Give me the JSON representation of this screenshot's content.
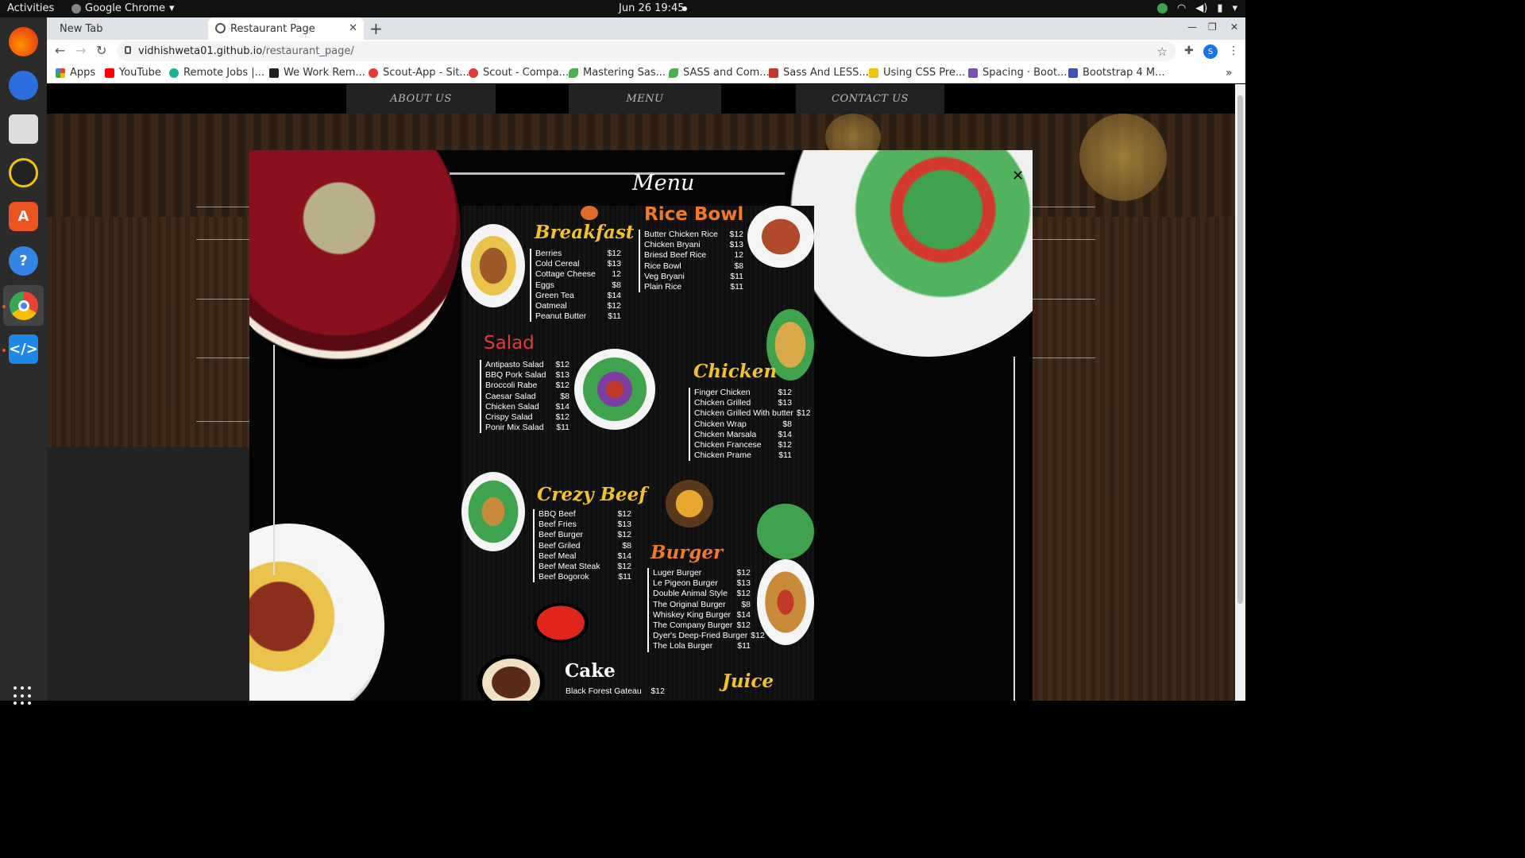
{
  "system": {
    "activities": "Activities",
    "app_name": "Google Chrome",
    "clock": "Jun 26  19:45"
  },
  "browser": {
    "tabs": [
      {
        "title": "New Tab"
      },
      {
        "title": "Restaurant Page"
      }
    ],
    "url_host": "vidhishweta01.github.io",
    "url_path": "/restaurant_page/",
    "profile_initial": "S",
    "bookmarks": [
      {
        "label": "Apps",
        "color": "#4285f4"
      },
      {
        "label": "YouTube",
        "color": "#ff0000"
      },
      {
        "label": "Remote Jobs |...",
        "color": "#1ab394"
      },
      {
        "label": "We Work Rem...",
        "color": "#222222"
      },
      {
        "label": "Scout-App - Sit...",
        "color": "#e53935"
      },
      {
        "label": "Scout - Compa...",
        "color": "#e53935"
      },
      {
        "label": "Mastering Sas...",
        "color": "#4caf50"
      },
      {
        "label": "SASS and Com...",
        "color": "#4caf50"
      },
      {
        "label": "Sass And LESS...",
        "color": "#c0392b"
      },
      {
        "label": "Using CSS Pre...",
        "color": "#f1c40f"
      },
      {
        "label": "Spacing · Boot...",
        "color": "#7952b3"
      },
      {
        "label": "Bootstrap 4 M...",
        "color": "#3f51b5"
      }
    ]
  },
  "site": {
    "nav": [
      "ABOUT US",
      "MENU",
      "CONTACT US"
    ]
  },
  "menu": {
    "title": "Menu",
    "sections": [
      {
        "title": "Breakfast",
        "color": "#f2c12e",
        "items": [
          {
            "name": "Berries",
            "price": "$12"
          },
          {
            "name": "Cold Cereal",
            "price": "$13"
          },
          {
            "name": "Cottage Cheese",
            "price": "12"
          },
          {
            "name": "Eggs",
            "price": "$8"
          },
          {
            "name": "Green Tea",
            "price": "$14"
          },
          {
            "name": "Oatmeal",
            "price": "$12"
          },
          {
            "name": "Peanut Butter",
            "price": "$11"
          }
        ]
      },
      {
        "title": "Rice Bowl",
        "color": "#f07a2a",
        "items": [
          {
            "name": "Butter Chicken Rice",
            "price": "$12"
          },
          {
            "name": "Chicken Bryani",
            "price": "$13"
          },
          {
            "name": "Briesd Beef Rice",
            "price": "12"
          },
          {
            "name": "Rice Bowl",
            "price": "$8"
          },
          {
            "name": "Veg Bryani",
            "price": "$11"
          },
          {
            "name": "Plain Rice",
            "price": "$11"
          }
        ]
      },
      {
        "title": "Salad",
        "color": "#e8363a",
        "items": [
          {
            "name": "Antipasto Salad",
            "price": "$12"
          },
          {
            "name": "BBQ Pork Salad",
            "price": "$13"
          },
          {
            "name": "Broccoli Rabe",
            "price": "$12"
          },
          {
            "name": "Caesar Salad",
            "price": "$8"
          },
          {
            "name": "Chicken Salad",
            "price": "$14"
          },
          {
            "name": "Crispy Salad",
            "price": "$12"
          },
          {
            "name": "Ponir Mix Salad",
            "price": "$11"
          }
        ]
      },
      {
        "title": "Chicken",
        "color": "#f2c12e",
        "items": [
          {
            "name": "Finger Chicken",
            "price": "$12"
          },
          {
            "name": "Chicken Grilled",
            "price": "$13"
          },
          {
            "name": "Chicken Grilled With butter",
            "price": "$12"
          },
          {
            "name": "Chicken Wrap",
            "price": "$8"
          },
          {
            "name": "Chicken Marsala",
            "price": "$14"
          },
          {
            "name": "Chicken Francese",
            "price": "$12"
          },
          {
            "name": "Chicken Prame",
            "price": "$11"
          }
        ]
      },
      {
        "title": "Crezy Beef",
        "color": "#f2c12e",
        "items": [
          {
            "name": "BBQ Beef",
            "price": "$12"
          },
          {
            "name": "Beef Fries",
            "price": "$13"
          },
          {
            "name": "Beef Burger",
            "price": "$12"
          },
          {
            "name": "Beef Griled",
            "price": "$8"
          },
          {
            "name": "Beef Meal",
            "price": "$14"
          },
          {
            "name": "Beef Meat Steak",
            "price": "$12"
          },
          {
            "name": "Beef Bogorok",
            "price": "$11"
          }
        ]
      },
      {
        "title": "Burger",
        "color": "#f07a2a",
        "items": [
          {
            "name": "Luger Burger",
            "price": "$12"
          },
          {
            "name": "Le Pigeon Burger",
            "price": "$13"
          },
          {
            "name": "Double Animal Style",
            "price": "$12"
          },
          {
            "name": "The Original Burger",
            "price": "$8"
          },
          {
            "name": "Whiskey King Burger",
            "price": "$14"
          },
          {
            "name": "The Company Burger",
            "price": "$12"
          },
          {
            "name": "Dyer's Deep-Fried Burger",
            "price": "$12"
          },
          {
            "name": "The Lola Burger",
            "price": "$11"
          }
        ]
      },
      {
        "title": "Cake",
        "color": "#ffffff",
        "items": [
          {
            "name": "Black Forest Gateau",
            "price": "$12"
          }
        ]
      },
      {
        "title": "Juice",
        "color": "#f2c12e",
        "items": []
      }
    ]
  }
}
